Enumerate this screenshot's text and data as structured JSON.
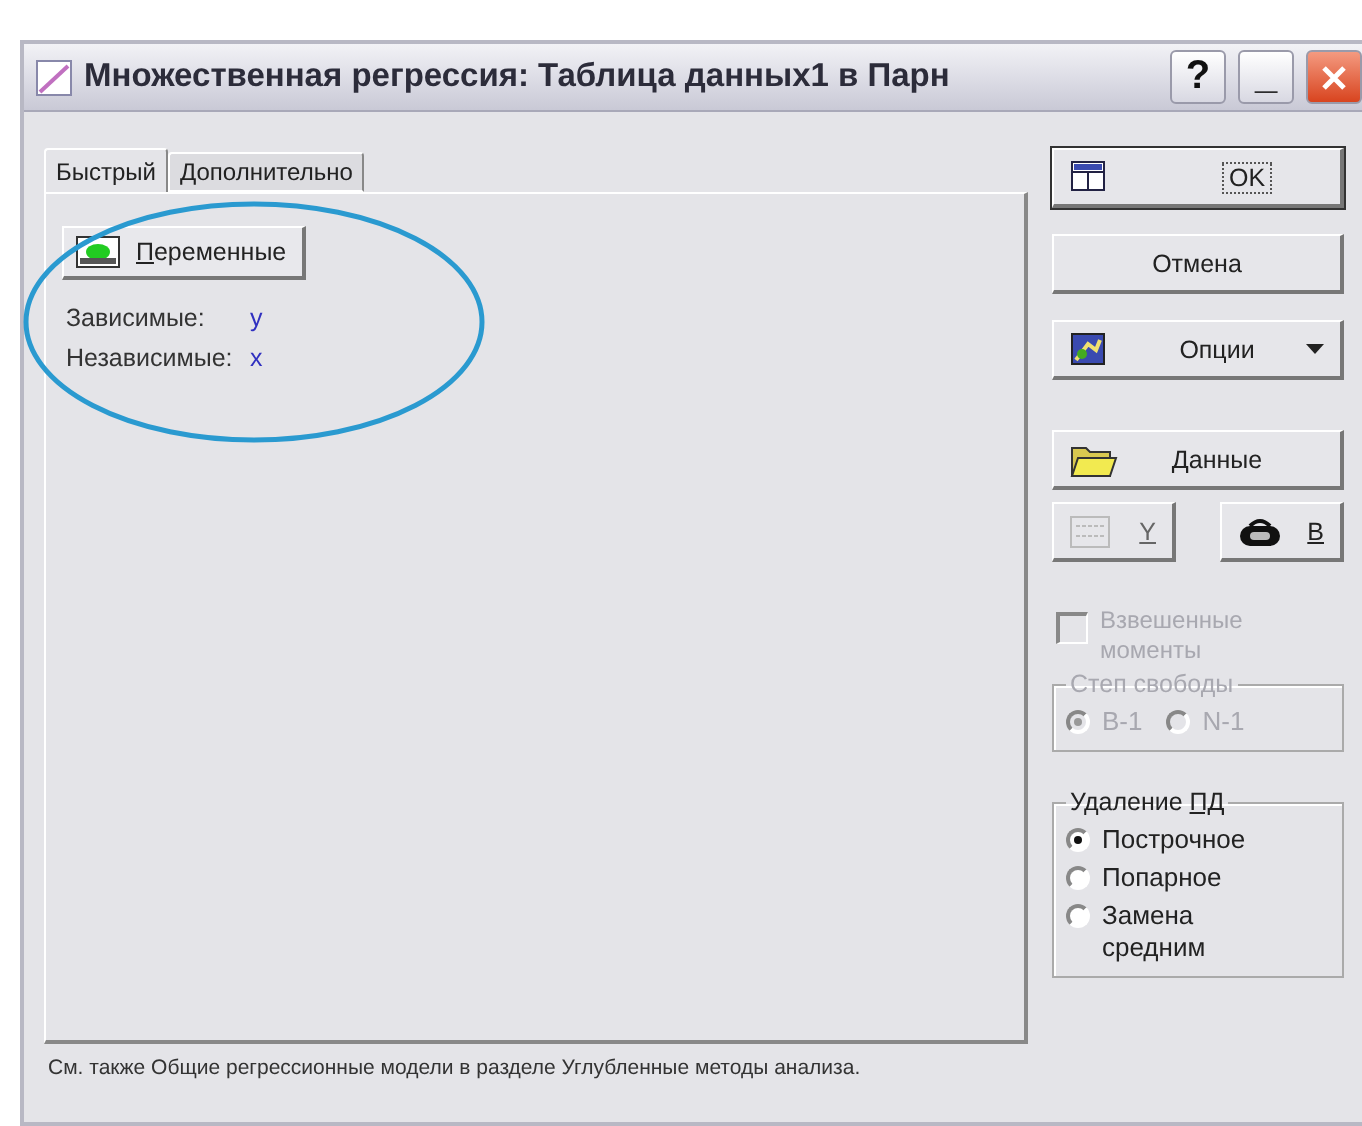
{
  "window": {
    "title": "Множественная регрессия: Таблица данных1 в Парн",
    "controls": [
      {
        "kind": "help",
        "label": "?"
      },
      {
        "kind": "minimize",
        "label": "_"
      },
      {
        "kind": "close"
      }
    ]
  },
  "tabs": [
    {
      "label": "Быстрый",
      "selected": true
    },
    {
      "label": "Дополнительно",
      "selected": false
    }
  ],
  "variables_button": {
    "key": "П",
    "post": "еременные"
  },
  "variables": [
    {
      "label": "Зависимые:",
      "value": "y"
    },
    {
      "label": "Независимые:",
      "value": "x"
    }
  ],
  "status_text": "См. также Общие регрессионные модели в разделе Углубленные методы анализа.",
  "buttons": [
    {
      "kind": "ok",
      "post": "OK",
      "focused": true
    },
    {
      "kind": "cancel",
      "post": "Отмена",
      "focused": false
    },
    {
      "kind": "options",
      "post": "Опции",
      "focused": false
    },
    {
      "kind": "data",
      "post": "Данные",
      "focused": false
    }
  ],
  "small_buttons": [
    {
      "kind": "select",
      "key": "Y",
      "disabled": true
    },
    {
      "kind": "weight",
      "key": "B",
      "disabled": false
    }
  ],
  "weighted_moments": {
    "label": "Взвешенные моменты",
    "checked": false,
    "disabled": true
  },
  "groups": [
    {
      "pre": "Степ свободы",
      "disabled": true,
      "horizontal": true,
      "options": [
        {
          "label": "В-1",
          "selected": true
        },
        {
          "label": "N-1",
          "selected": false
        }
      ]
    },
    {
      "pre": "Удаление ",
      "key": "ПД",
      "disabled": false,
      "horizontal": false,
      "options": [
        {
          "label": "Построчное",
          "selected": true
        },
        {
          "label": "Попарное",
          "selected": false
        },
        {
          "label": "Замена средним",
          "selected": false
        }
      ]
    }
  ]
}
